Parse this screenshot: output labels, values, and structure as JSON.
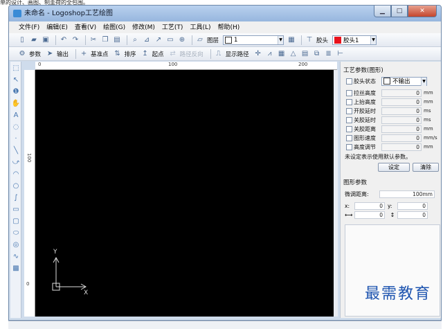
{
  "caption": "单的设计、画图、制圭荷的全包围。",
  "window": {
    "title": "未命名 - Logoshop工艺绘图"
  },
  "menu": [
    {
      "label": "文件(F)"
    },
    {
      "label": "编辑(E)"
    },
    {
      "label": "查看(V)"
    },
    {
      "label": "绘图(G)"
    },
    {
      "label": "修改(M)"
    },
    {
      "label": "工艺(T)"
    },
    {
      "label": "工具(L)"
    },
    {
      "label": "帮助(H)"
    }
  ],
  "toolbar1": {
    "layer_label": "图层",
    "layer_value": "1",
    "glue_label": "胶头",
    "glue_value": "胶头1",
    "glue_color": "#e8121c"
  },
  "toolbar2": {
    "params_label": "参数",
    "output_label": "输出",
    "base_point_label": "基准点",
    "sort_label": "排序",
    "start_label": "起点",
    "reverse_label": "路径反向",
    "show_path_label": "显示路径"
  },
  "ruler": {
    "top_0": "0",
    "top_100": "100",
    "top_200": "200",
    "left_100": "100",
    "left_0": "0"
  },
  "canvas": {
    "x_label": "X",
    "y_label": "Y",
    "background": "#000000"
  },
  "panel": {
    "process_title": "工艺参数(图形)",
    "glue_state_label": "胶头状态",
    "glue_state_value": "不输出",
    "params": [
      {
        "label": "拉丝高度",
        "value": "0",
        "unit": "mm"
      },
      {
        "label": "上抬高度",
        "value": "0",
        "unit": "mm"
      },
      {
        "label": "开胶延时",
        "value": "0",
        "unit": "ms"
      },
      {
        "label": "关胶延时",
        "value": "0",
        "unit": "ms"
      },
      {
        "label": "关胶距离",
        "value": "0",
        "unit": "mm"
      },
      {
        "label": "图形速度",
        "value": "0",
        "unit": "mm/s"
      },
      {
        "label": "高度调节",
        "value": "0",
        "unit": "mm"
      }
    ],
    "hint": "未设定表示使用默认参数。",
    "set_button": "设定",
    "clear_button": "清除",
    "graph_title": "图形参数",
    "fine_tune_label": "微调距离:",
    "fine_tune_value": "100mm",
    "x_label": "x:",
    "x_value": "0",
    "y_label": "y:",
    "y_value": "0",
    "w_value": "0",
    "h_value": "0"
  },
  "watermark": "最需教育"
}
